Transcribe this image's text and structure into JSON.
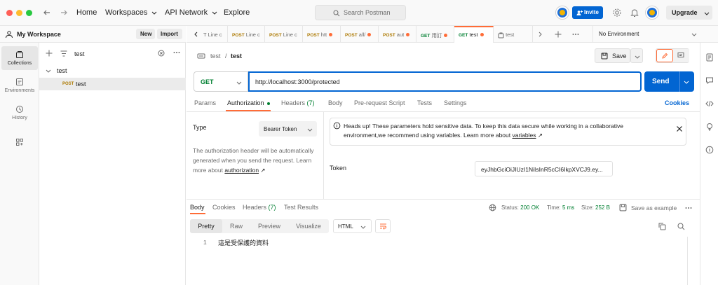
{
  "colors": {
    "accent": "#ff6c37",
    "primary": "#0265d2",
    "get": "#007f31",
    "post": "#ad7a03",
    "success": "#007f31"
  },
  "titlebar": {
    "nav": {
      "home": "Home",
      "workspaces": "Workspaces",
      "api_network": "API Network",
      "explore": "Explore"
    },
    "search_placeholder": "Search Postman",
    "invite": "Invite",
    "upgrade": "Upgrade"
  },
  "workspace": {
    "name": "My Workspace",
    "new_label": "New",
    "import_label": "Import"
  },
  "rail": [
    {
      "label": "Collections",
      "icon": "collections-icon"
    },
    {
      "label": "Environments",
      "icon": "environments-icon"
    },
    {
      "label": "History",
      "icon": "history-icon"
    },
    {
      "label": "",
      "icon": "apps-icon"
    }
  ],
  "sidebar": {
    "filter_value": "test",
    "tree": {
      "collection": "test",
      "request_method": "POST",
      "request_name": "test"
    }
  },
  "tabs": [
    {
      "method": "",
      "label": "T Line c"
    },
    {
      "method": "POST",
      "label": "Line c"
    },
    {
      "method": "POST",
      "label": "Line c"
    },
    {
      "method": "POST",
      "label": "htt"
    },
    {
      "method": "POST",
      "label": "all/"
    },
    {
      "method": "POST",
      "label": "aut"
    },
    {
      "method": "GET",
      "label": "用訂"
    },
    {
      "method": "GET",
      "label": "test"
    },
    {
      "method": "",
      "label": "test"
    }
  ],
  "environment": "No Environment",
  "request": {
    "breadcrumb_parent": "test",
    "breadcrumb_sep": "/",
    "name": "test",
    "save_label": "Save",
    "method": "GET",
    "url": "http://localhost:3000/protected",
    "send_label": "Send",
    "tabs": {
      "params": "Params",
      "authorization": "Authorization",
      "headers": "Headers",
      "headers_count": "(7)",
      "body": "Body",
      "prerequest": "Pre-request Script",
      "tests": "Tests",
      "settings": "Settings",
      "cookies": "Cookies"
    }
  },
  "auth": {
    "type_label": "Type",
    "type_value": "Bearer Token",
    "description": "The authorization header will be automatically generated when you send the request. Learn more about",
    "description_link": "authorization",
    "link_arrow": "↗",
    "info_text": "Heads up! These parameters hold sensitive data. To keep this data secure while working in a collaborative environment,we recommend using variables. Learn more about",
    "info_link": "variables",
    "token_label": "Token",
    "token_value": "eyJhbGciOiJIUzI1NiIsInR5cCI6IkpXVCJ9.ey..."
  },
  "response": {
    "tabs": {
      "body": "Body",
      "cookies": "Cookies",
      "headers": "Headers",
      "headers_count": "(7)",
      "test_results": "Test Results"
    },
    "status_label": "Status:",
    "status_value": "200 OK",
    "time_label": "Time:",
    "time_value": "5 ms",
    "size_label": "Size:",
    "size_value": "252 B",
    "save_example": "Save as example",
    "view_modes": [
      "Pretty",
      "Raw",
      "Preview",
      "Visualize"
    ],
    "format": "HTML",
    "line_number": "1",
    "body_text": "這是受保護的資料"
  }
}
